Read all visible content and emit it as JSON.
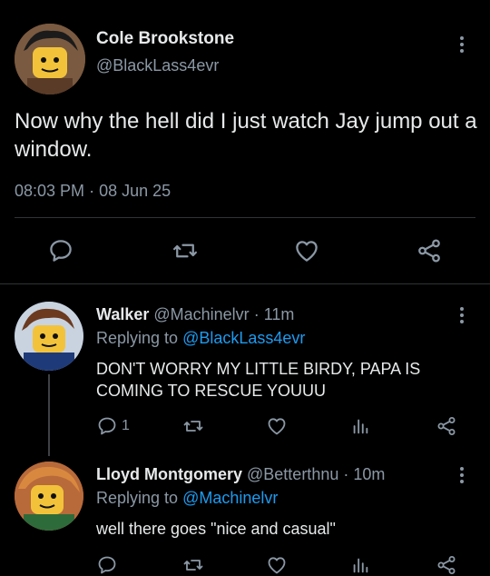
{
  "main_tweet": {
    "display_name": "Cole Brookstone",
    "handle": "@BlackLass4evr",
    "text": "Now why the hell did I just watch Jay jump out a window.",
    "time": "08:03 PM",
    "sep": "·",
    "date": "08 Jun 25",
    "actions": [
      "reply-icon",
      "retweet-icon",
      "like-icon",
      "share-icon"
    ]
  },
  "replies": [
    {
      "display_name": "Walker",
      "handle": "@Machinelvr",
      "sep": "·",
      "age": "11m",
      "replying_prefix": "Replying to ",
      "replying_to": "@BlackLass4evr",
      "text": "DON'T WORRY MY LITTLE BIRDY, PAPA IS COMING TO RESCUE YOUUU",
      "reply_count": "1"
    },
    {
      "display_name": "Lloyd Montgomery",
      "handle": "@Betterthnu",
      "sep": "·",
      "age": "10m",
      "replying_prefix": "Replying to ",
      "replying_to": "@Machinelvr",
      "text": "well there goes \"nice and casual\"",
      "reply_count": ""
    }
  ],
  "colors": {
    "background": "#000000",
    "text": "#e7e9ea",
    "muted": "#8b98a5",
    "link": "#1d9bf0",
    "divider": "#2f3336"
  }
}
